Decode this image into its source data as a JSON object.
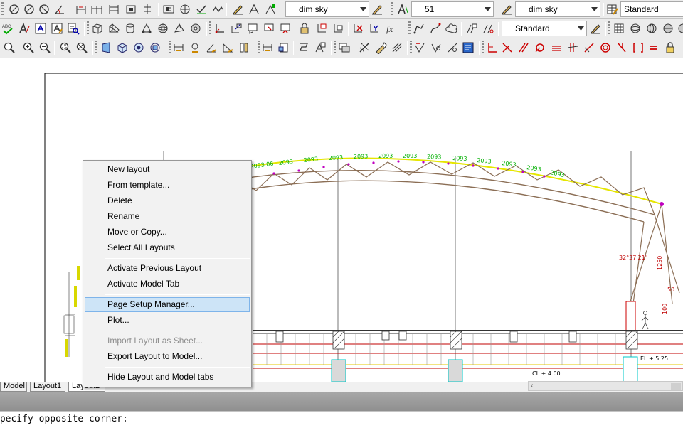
{
  "toolbar": {
    "dimstyle_value": "dim sky",
    "text_height_value": "51",
    "dimstyle2_value": "dim sky",
    "textstyle_value": "Standard",
    "tablestyle_value": "Standard"
  },
  "drawing": {
    "truss_labels": [
      "2093.06",
      "2093",
      "2093",
      "2093",
      "2093",
      "2093",
      "2093",
      "2093",
      "2093",
      "2093",
      "2093",
      "2093",
      "2093"
    ],
    "angle_label": "32°37'21\"",
    "level_label_1": "EL + 5.25",
    "level_label_2": "CL + 4.00",
    "small_label_1": "1250",
    "small_label_2": "50",
    "small_label_3": "100"
  },
  "context_menu": {
    "items": [
      {
        "label": "New layout",
        "enabled": true
      },
      {
        "label": "From template...",
        "enabled": true
      },
      {
        "label": "Delete",
        "enabled": true
      },
      {
        "label": "Rename",
        "enabled": true
      },
      {
        "label": "Move or Copy...",
        "enabled": true
      },
      {
        "label": "Select All Layouts",
        "enabled": true
      },
      {
        "label": "Activate Previous Layout",
        "enabled": true
      },
      {
        "label": "Activate Model Tab",
        "enabled": true
      },
      {
        "label": "Page Setup Manager...",
        "enabled": true,
        "highlighted": true
      },
      {
        "label": "Plot...",
        "enabled": true
      },
      {
        "label": "Import Layout as Sheet...",
        "enabled": false
      },
      {
        "label": "Export Layout to Model...",
        "enabled": true
      },
      {
        "label": "Hide Layout and Model tabs",
        "enabled": true
      }
    ]
  },
  "layout_tabs": [
    {
      "label": "Model",
      "active": false
    },
    {
      "label": "Layout1",
      "active": false
    },
    {
      "label": "Layout2",
      "active": true
    }
  ],
  "command_line": {
    "text": "Specify opposite corner:"
  },
  "colors": {
    "accent_highlight": "#cde4f7",
    "truss": "#8b6e55",
    "dimension_green": "#00b000",
    "chord_yellow": "#e6e600",
    "red_lines": "#e00000",
    "cyan_lines": "#00c8c8"
  },
  "icons": {
    "row1": [
      "arc-icon",
      "circle-icon",
      "ellipse-icon",
      "angle-dim-icon",
      "dim-baseline-icon",
      "dim-continue-icon",
      "dim-linear-icon",
      "tolerance-icon",
      "center-mark-icon",
      "inspect-icon",
      "jogged-icon",
      "dim-edit-icon",
      "dim-text-edit-icon",
      "dim-update-icon",
      "dimstyle-icon",
      "text-style-icon",
      "text-height-icon",
      "mleader-style-icon",
      "table-style-icon"
    ],
    "row2": [
      "spell-check-icon",
      "text-icon",
      "mtext-icon",
      "text-edit-icon",
      "find-replace-icon",
      "box-icon",
      "wedge-icon",
      "cylinder-icon",
      "cone-icon",
      "sphere-icon",
      "torus-icon",
      "pyramid-icon",
      "ucs-icon",
      "ucs-world-icon",
      "ucs-object-icon",
      "ucs-face-icon",
      "ucs-view-icon",
      "ucs-origin-icon",
      "ucs-zaxis-icon",
      "ucs-3point-icon",
      "ucs-x-icon",
      "field-icon",
      "polyline-icon",
      "spline-icon",
      "revcloud-icon",
      "table-icon",
      "render-icon"
    ],
    "row3": [
      "zoom-realtime-icon",
      "zoom-window-icon",
      "zoom-previous-icon",
      "zoom-dynamic-icon",
      "zoom-scale-icon",
      "orbit-icon",
      "view-front-icon",
      "view-top-icon",
      "view-iso-icon",
      "match-prop-icon",
      "layer-icon",
      "layer-off-icon",
      "layer-freeze-icon",
      "block-icon",
      "insert-icon",
      "hatch-icon",
      "region-icon",
      "measure-icon",
      "erase-icon",
      "copy-icon",
      "mirror-icon",
      "offset-icon",
      "array-icon",
      "move-icon",
      "rotate-icon",
      "scale-icon",
      "stretch-icon",
      "trim-icon",
      "extend-icon",
      "break-icon",
      "join-icon",
      "chamfer-icon",
      "fillet-icon",
      "explode-icon",
      "lock-icon"
    ]
  }
}
